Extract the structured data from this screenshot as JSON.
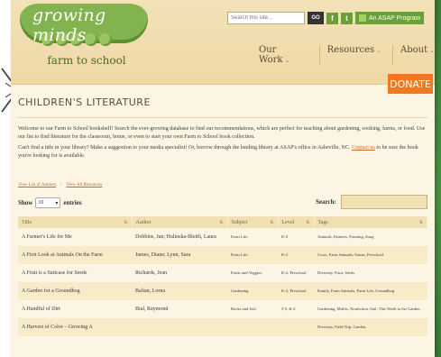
{
  "site": {
    "logo_top": "growing minds",
    "logo_bottom": "farm to school",
    "search_placeholder": "Search this site...",
    "go_label": "GO",
    "facebook_icon": "facebook-icon",
    "twitter_icon": "twitter-icon",
    "asap_label": "An ASAP Program"
  },
  "nav": {
    "items": [
      {
        "label": "Our Work"
      },
      {
        "label": "Resources"
      },
      {
        "label": "About"
      }
    ],
    "caret": "⌄"
  },
  "page": {
    "title": "CHILDREN'S LITERATURE",
    "donate_label": "DONATE",
    "intro_p1": "Welcome to our Farm to School bookshelf! Search the ever-growing database to find our recommendations, which are perfect for teaching about gardening, cooking, farms, or food. Use our list to find literature for the classroom, home, or even to start your own Farm to School book collection.",
    "intro_p2_a": "Can't find a title in your library? Make a suggestion to your media specialist! Or, borrow through the lending library at ASAP's office in Asheville, NC.",
    "intro_p2_link": "Contact us",
    "intro_p2_b": "to be sure the book you're looking for is available.",
    "link_authors": "View List of Authors",
    "link_sep": "|",
    "link_resources": "View All Resources"
  },
  "table_controls": {
    "show_label": "Show",
    "show_value": "10",
    "entries_label": "entries",
    "search_label": "Search:"
  },
  "table": {
    "headers": [
      "Title",
      "Author",
      "Subject",
      "Level",
      "Tags"
    ],
    "rows": [
      {
        "title": "A Farmer's Life for Me",
        "author": "Dobbins, Jan; Hulinska-Bleith, Laura",
        "subject": "Farm Life",
        "level": "K-2",
        "tags": "Animals, Farmers, Farming, Song"
      },
      {
        "title": "A First Look at Animals On the Farm",
        "author": "James, Diane; Lynn, Sara",
        "subject": "Farm Life",
        "level": "K-2",
        "tags": "Cows, Farm Animals, Farms, Preschool"
      },
      {
        "title": "A Fruit is a Suitcase for Seeds",
        "author": "Richards, Jean",
        "subject": "Fruits and Veggies",
        "level": "K-2, Preschool",
        "tags": "Diversity, Fruit, Seeds"
      },
      {
        "title": "A Garden for a Groundhog",
        "author": "Balian, Lorna",
        "subject": "Gardening",
        "level": "K-2, Preschool",
        "tags": "Family, Farm Animals, Farm Life, Groundhog"
      },
      {
        "title": "A Handful of Dirt",
        "author": "Bial, Raymond",
        "subject": "Rocks and Soil",
        "level": "3-5, K-2",
        "tags": "Gardening, Mulch, Nonfiction, Soil, This Week in the Garden"
      },
      {
        "title": "A Harvest of Color – Growing A",
        "author": "",
        "subject": "",
        "level": "",
        "tags": "Diversity, Field Trip, Garden,"
      }
    ]
  }
}
